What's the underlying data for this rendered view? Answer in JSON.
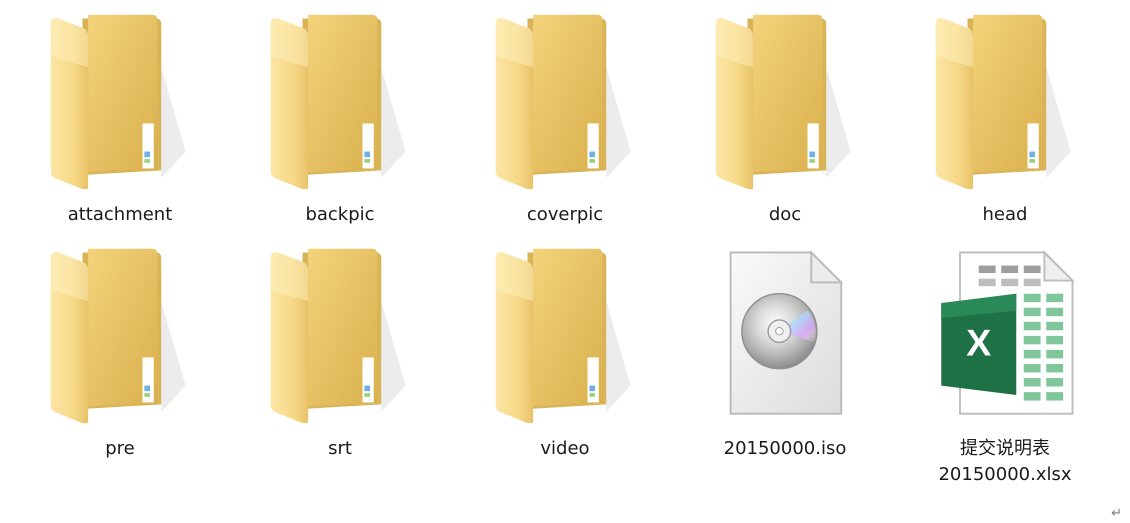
{
  "colors": {
    "folder_back": "#e9c76a",
    "folder_front": "#f7dc8c",
    "label_text": "#1a1a1a",
    "excel_green": "#1e7145",
    "disc_silver": "#c9c9c9"
  },
  "items": [
    {
      "label": "attachment",
      "type": "folder",
      "icon": "folder-icon"
    },
    {
      "label": "backpic",
      "type": "folder",
      "icon": "folder-icon"
    },
    {
      "label": "coverpic",
      "type": "folder",
      "icon": "folder-icon"
    },
    {
      "label": "doc",
      "type": "folder",
      "icon": "folder-icon"
    },
    {
      "label": "head",
      "type": "folder",
      "icon": "folder-icon"
    },
    {
      "label": "pre",
      "type": "folder",
      "icon": "folder-icon"
    },
    {
      "label": "srt",
      "type": "folder",
      "icon": "folder-icon"
    },
    {
      "label": "video",
      "type": "folder",
      "icon": "folder-icon"
    },
    {
      "label": "20150000.iso",
      "type": "disc-image",
      "icon": "disc-image-file-icon"
    },
    {
      "label_line1": "提交说明表",
      "label_line2": "20150000.xlsx",
      "type": "excel",
      "icon": "excel-file-icon",
      "excel_letter": "X"
    }
  ],
  "paragraph_mark": "↵"
}
